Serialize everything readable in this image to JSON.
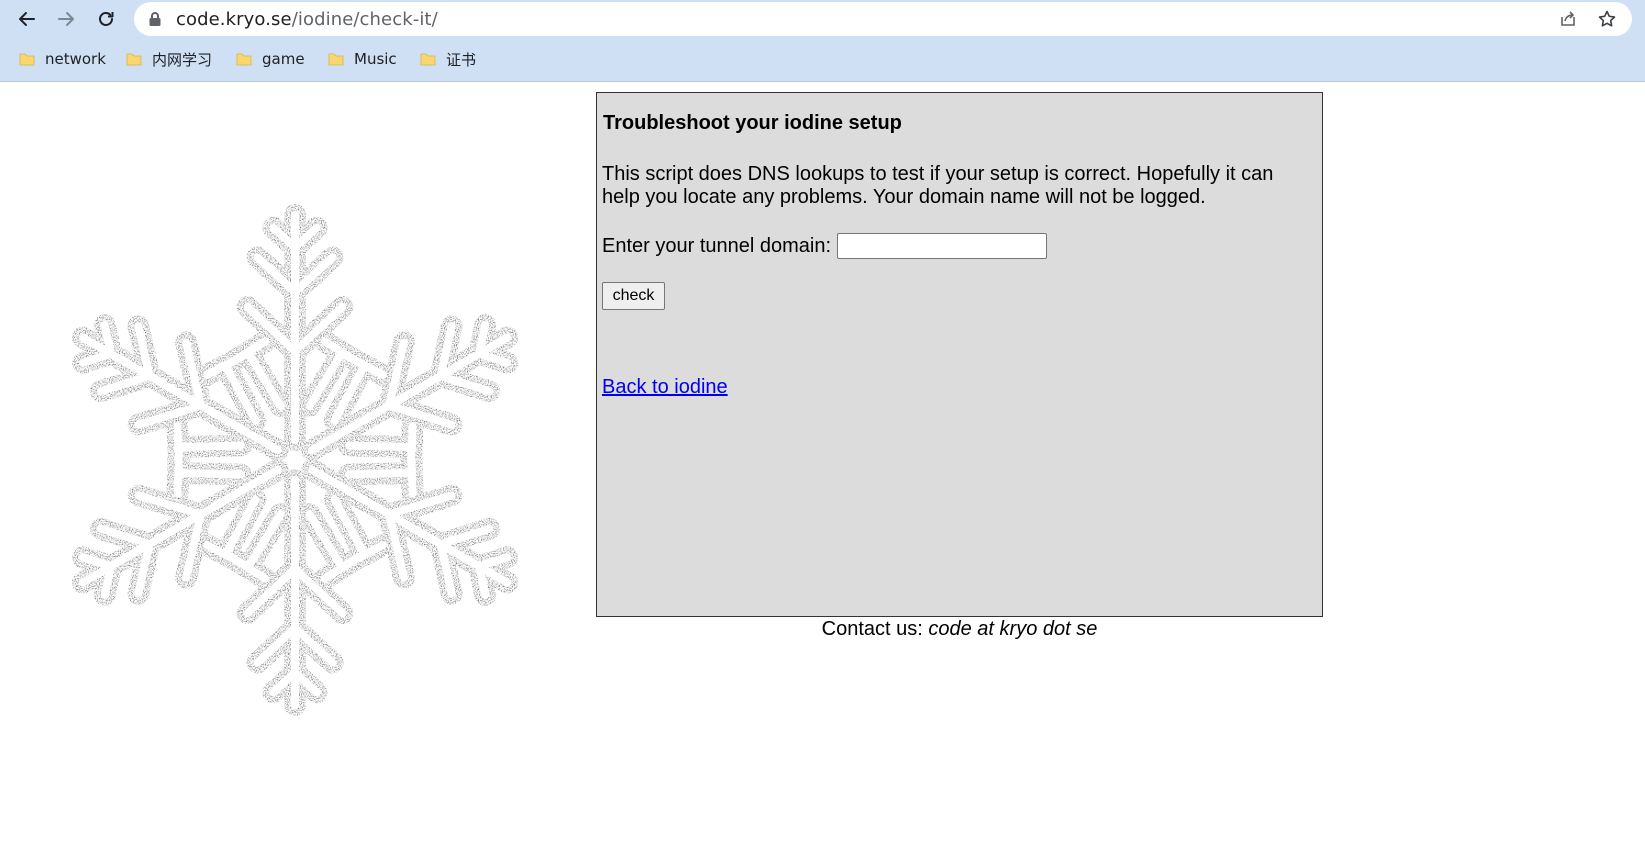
{
  "browser": {
    "url_host": "code.kryo.se",
    "url_path": "/iodine/check-it/",
    "bookmarks": [
      {
        "label": "network"
      },
      {
        "label": "内网学习"
      },
      {
        "label": "game"
      },
      {
        "label": "Music"
      },
      {
        "label": "证书"
      }
    ]
  },
  "page": {
    "heading": "Troubleshoot your iodine setup",
    "description": "This script does DNS lookups to test if your setup is correct. Hopefully it can help you locate any problems. Your domain name will not be logged.",
    "domain_label": "Enter your tunnel domain:",
    "domain_value": "",
    "check_label": "check",
    "back_link": "Back to iodine",
    "contact_prefix": "Contact us:",
    "contact_email": "code at kryo dot se"
  },
  "icons": {
    "back": "back-arrow-icon",
    "forward": "forward-arrow-icon",
    "reload": "reload-icon",
    "lock": "lock-icon",
    "share": "share-icon",
    "star": "star-icon",
    "folder": "folder-icon",
    "logo": "snowflake-logo"
  },
  "colors": {
    "chrome": "#cfe0f5",
    "panel": "#dcdcdc",
    "link": "#0000ee",
    "folder": "#f9d76e"
  }
}
